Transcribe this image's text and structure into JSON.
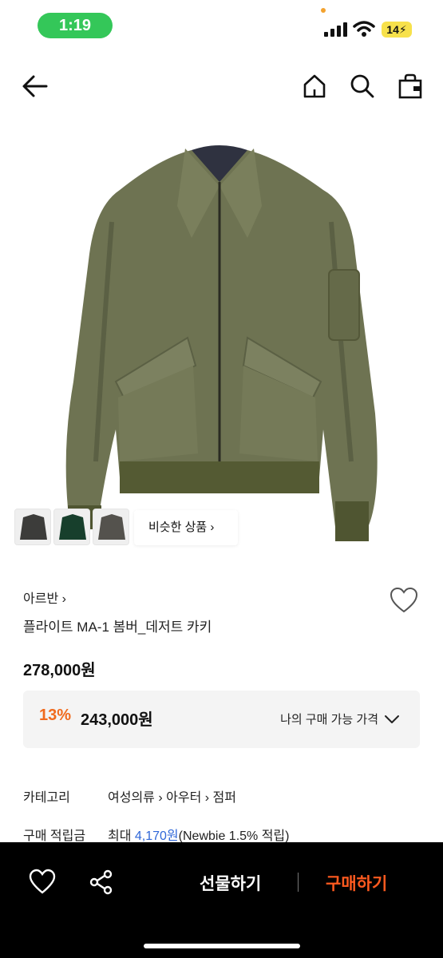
{
  "status": {
    "time": "1:19",
    "battery": "14"
  },
  "nav": {
    "back": "back-arrow-icon",
    "home": "home-icon",
    "search": "search-icon",
    "cart": "bag-icon"
  },
  "thumbs": [
    "dark-gray-jacket",
    "green-jacket",
    "gray-jacket"
  ],
  "similar_label": "비슷한 상품",
  "product": {
    "brand": "아르반",
    "name": "플라이트 MA-1 봄버_데저트 카키",
    "price": "278,000원",
    "discount": "13%",
    "discount_price": "243,000원",
    "my_price_label": "나의 구매 가능 가격"
  },
  "info": {
    "category_label": "카테고리",
    "category_1": "여성의류",
    "category_2": "아우터",
    "category_3": "점퍼",
    "points_label": "구매 적립금",
    "points_prefix": "최대 ",
    "points_amount": "4,170원",
    "points_suffix": "(Newbie 1.5% 적립)"
  },
  "bottom": {
    "gift": "선물하기",
    "buy": "구매하기"
  },
  "colors": {
    "accent": "#f06a1d",
    "buy": "#ff5a1f",
    "link": "#2f67d8"
  }
}
